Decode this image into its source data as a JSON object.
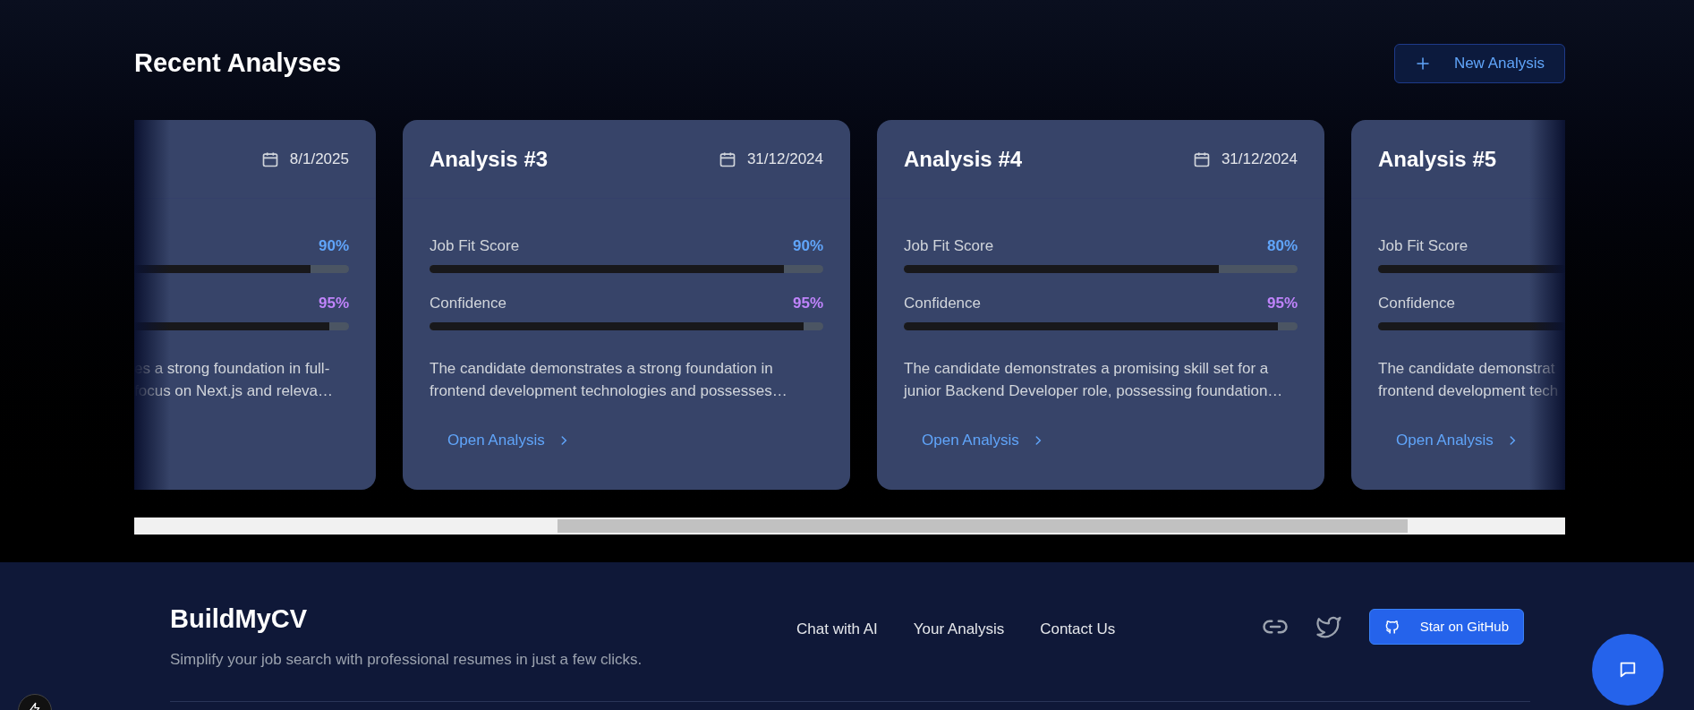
{
  "section": {
    "title": "Recent Analyses",
    "new_button": "New Analysis"
  },
  "cards": [
    {
      "kind": "partial-left",
      "date": "8/1/2025",
      "metrics": [
        {
          "kind": "fit",
          "value": "90%",
          "level": 0.82
        },
        {
          "kind": "confidence",
          "value": "95%",
          "level": 0.91
        }
      ],
      "description": [
        "es a strong foundation in full-",
        "focus on Next.js and releva…"
      ]
    },
    {
      "kind": "full",
      "title": "Analysis #3",
      "date": "31/12/2024",
      "metrics": [
        {
          "kind": "fit",
          "label": "Job Fit Score",
          "value": "90%",
          "level": 0.9
        },
        {
          "kind": "confidence",
          "label": "Confidence",
          "value": "95%",
          "level": 0.95
        }
      ],
      "description": [
        "The candidate demonstrates a strong foundation in",
        "frontend development technologies and possesses…"
      ],
      "link": "Open Analysis"
    },
    {
      "kind": "full",
      "title": "Analysis #4",
      "date": "31/12/2024",
      "metrics": [
        {
          "kind": "fit",
          "label": "Job Fit Score",
          "value": "80%",
          "level": 0.8
        },
        {
          "kind": "confidence",
          "label": "Confidence",
          "value": "95%",
          "level": 0.95
        }
      ],
      "description": [
        "The candidate demonstrates a promising skill set for a",
        "junior Backend Developer role, possessing foundation…"
      ],
      "link": "Open Analysis"
    },
    {
      "kind": "partial-right",
      "title": "Analysis #5",
      "metrics": [
        {
          "label": "Job Fit Score"
        },
        {
          "label": "Confidence"
        }
      ],
      "description": [
        "The candidate demonstrat",
        "frontend development tech"
      ],
      "link": "Open Analysis"
    }
  ],
  "footer": {
    "brand": "BuildMyCV",
    "tagline": "Simplify your job search with professional resumes in just a few clicks.",
    "links": [
      "Chat with AI",
      "Your Analysis",
      "Contact Us"
    ],
    "github_button": "Star on GitHub"
  }
}
